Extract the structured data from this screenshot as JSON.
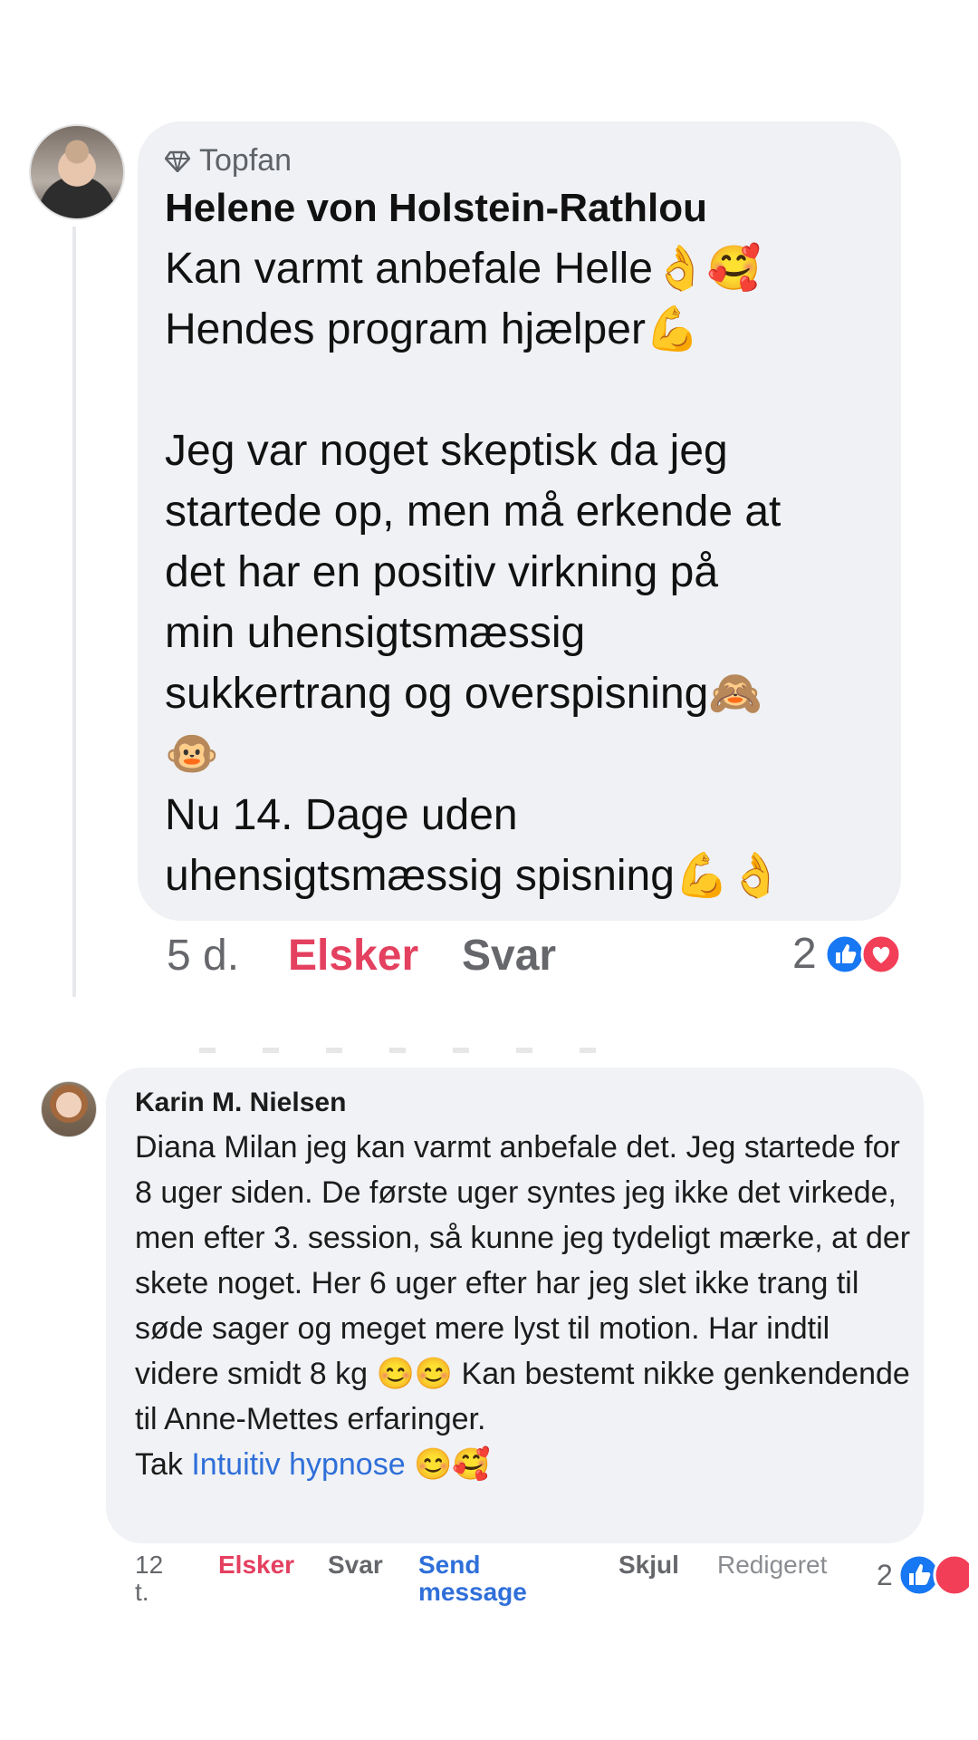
{
  "comment1": {
    "badge": "Topfan",
    "badge_icon": "diamond-icon",
    "author": "Helene von Holstein-Rathlou",
    "text": "Kan varmt anbefale Helle👌🥰\nHendes program hjælper💪\n\nJeg var noget skeptisk da jeg\nstartede op, men må erkende at\ndet har en positiv virkning på\nmin uhensigtsmæssig\nsukkertrang og overspisning🙈\n🐵\nNu 14. Dage uden\nuhensigtsmæssig spisning💪👌",
    "time": "5 d.",
    "love": "Elsker",
    "reply": "Svar",
    "reaction_count": "2",
    "reactions": [
      "like-icon",
      "heart-icon"
    ]
  },
  "comment2": {
    "author": "Karin M. Nielsen",
    "text": "Diana Milan jeg kan varmt anbefale det. Jeg startede for 8 uger siden. De første uger syntes jeg ikke det virkede, men efter 3. session, så kunne jeg tydeligt mærke, at der skete noget. Her 6 uger efter har jeg slet ikke trang til søde sager og meget mere lyst til motion. Har indtil videre smidt 8 kg 😊😊 Kan bestemt nikke genkendende til Anne-Mettes erfaringer.",
    "thanks_prefix": "Tak ",
    "thanks_link": "Intuitiv hypnose",
    "thanks_suffix": " 😊🥰",
    "time": "12 t.",
    "love": "Elsker",
    "reply": "Svar",
    "send_message": "Send message",
    "hide": "Skjul",
    "edited": "Redigeret",
    "reaction_count": "2",
    "reactions": [
      "like-icon",
      "heart-icon"
    ]
  },
  "colors": {
    "bubble": "#eff1f4",
    "love": "#e4405f",
    "link": "#2f6fd9",
    "like": "#1877f2",
    "heart": "#f33e58"
  }
}
